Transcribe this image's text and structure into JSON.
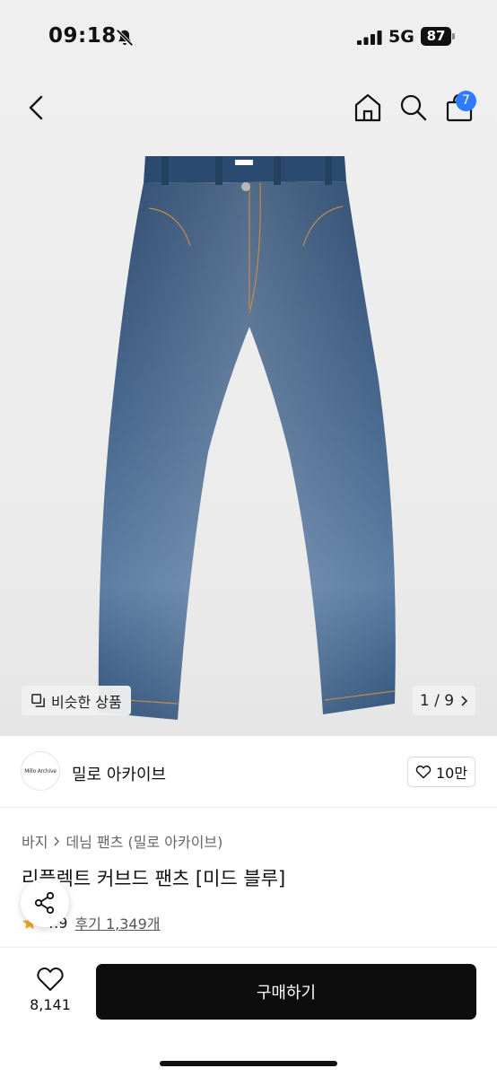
{
  "status_bar": {
    "time": "09:18",
    "network": "5G",
    "battery": "87"
  },
  "nav": {
    "cart_count": "7"
  },
  "gallery": {
    "similar_label": "비슷한 상품",
    "pager": "1 / 9"
  },
  "shop": {
    "logo_text": "Millo Archive",
    "name": "밀로 아카이브",
    "likes": "10만"
  },
  "product": {
    "breadcrumb": [
      "바지",
      "데님 팬츠 (밀로 아카이브)"
    ],
    "title": "리플렉트 커브드 팬츠 [미드 블루]",
    "rating": "4.9",
    "reviews": "후기 1,349개"
  },
  "bottom": {
    "wish_count": "8,141",
    "buy_label": "구매하기"
  },
  "colors": {
    "badge": "#2e7bff",
    "buy_button": "#0d0d0d",
    "star": "#f5a623"
  }
}
